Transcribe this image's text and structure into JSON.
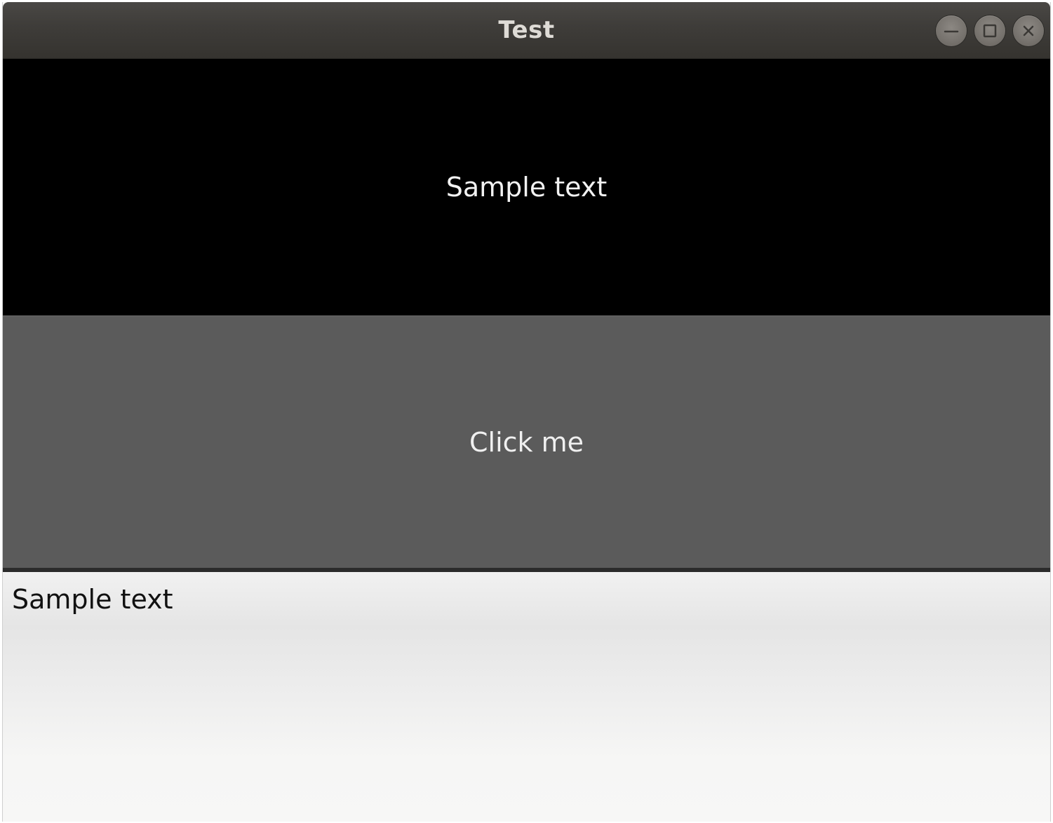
{
  "window": {
    "title": "Test",
    "controls": {
      "minimize_icon": "minimize-icon",
      "maximize_icon": "maximize-icon",
      "close_icon": "close-icon"
    }
  },
  "top_label": {
    "text": "Sample text"
  },
  "button": {
    "label": "Click me"
  },
  "bottom_label": {
    "text": "Sample text"
  },
  "colors": {
    "titlebar": "#3f3d3a",
    "top_panel_bg": "#000000",
    "button_bg": "#5b5b5b",
    "bottom_panel_bg": "#eeeeee"
  }
}
